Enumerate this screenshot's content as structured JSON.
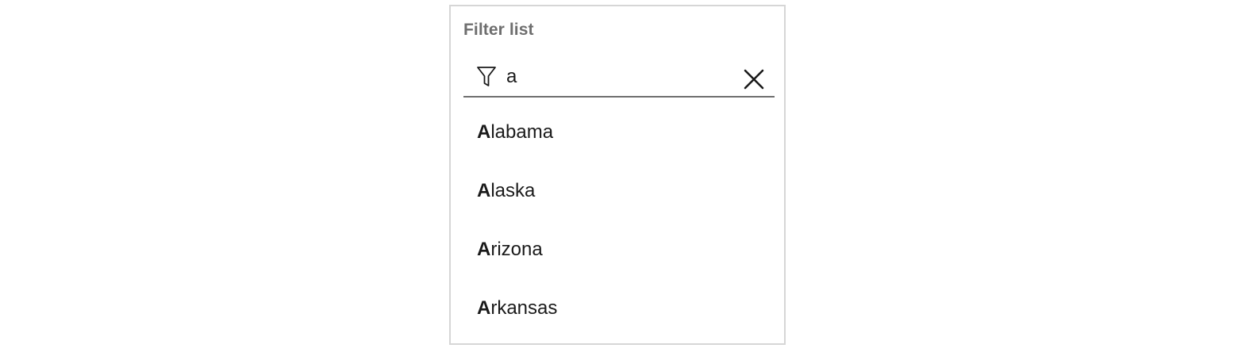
{
  "panel": {
    "title": "Filter list"
  },
  "filter": {
    "value": "a",
    "icon": "filter-funnel-icon",
    "clear_icon": "close-icon"
  },
  "results": [
    {
      "match": "A",
      "rest": "labama"
    },
    {
      "match": "A",
      "rest": "laska"
    },
    {
      "match": "A",
      "rest": "rizona"
    },
    {
      "match": "A",
      "rest": "rkansas"
    }
  ],
  "colors": {
    "border": "#d6d6d6",
    "title": "#6e6e6e",
    "underline": "#6e6e6e",
    "text": "#1a1a1a"
  }
}
